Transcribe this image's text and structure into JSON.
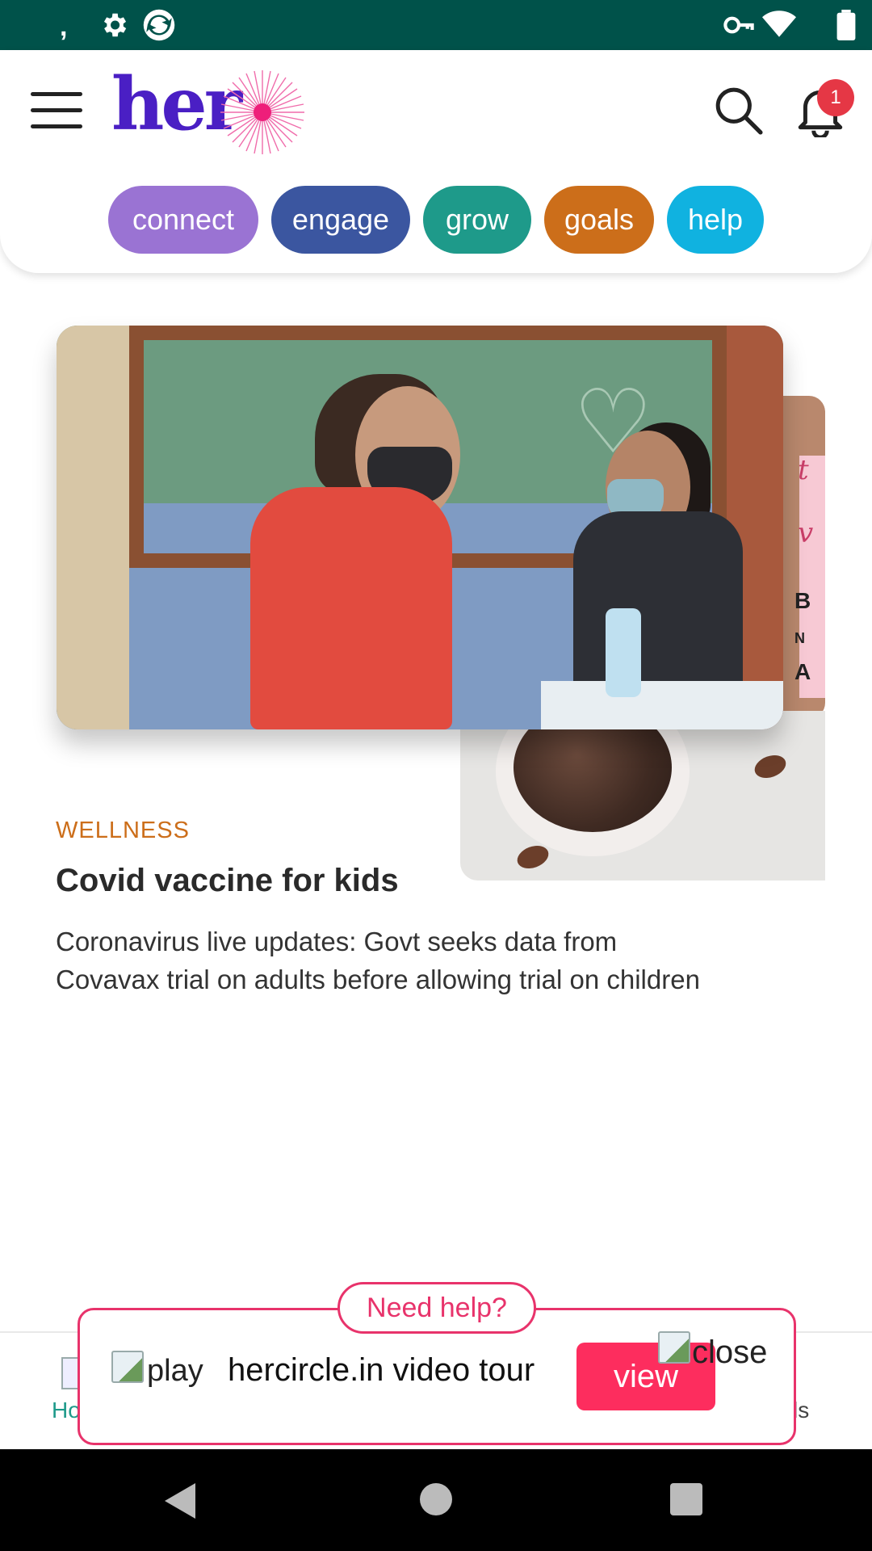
{
  "status_bar": {
    "left_text": ",",
    "icons": [
      "settings-gear-icon",
      "app-notification-icon",
      "vpn-key-icon",
      "wifi-icon",
      "battery-icon"
    ],
    "background_color": "#00524a"
  },
  "header": {
    "logo_text": "her",
    "notification_count": "1",
    "icons": [
      "menu-icon",
      "search-icon",
      "bell-icon"
    ],
    "pills": [
      {
        "label": "connect",
        "color": "#9a73d3"
      },
      {
        "label": "engage",
        "color": "#3b56a0"
      },
      {
        "label": "grow",
        "color": "#1e9a8a"
      },
      {
        "label": "goals",
        "color": "#cc6e1a"
      },
      {
        "label": "help",
        "color": "#10b2e0"
      }
    ]
  },
  "featured": {
    "category": "WELLNESS",
    "title": "Covid vaccine for kids",
    "summary": "Coronavirus live updates: Govt seeks data from Covavax trial on adults before allowing trial on children",
    "category_color": "#cc6e1a"
  },
  "bottom_nav": {
    "home_label": "Ho",
    "goals_label": "ls"
  },
  "help_popup": {
    "tab_label": "Need help?",
    "play_alt": "play",
    "tour_text": "hercircle.in video tour",
    "view_label": "view",
    "close_alt": "close",
    "accent_color": "#e8336b",
    "button_color": "#fd2d5e"
  },
  "system_nav": {
    "icons": [
      "back-icon",
      "home-icon",
      "recents-icon"
    ]
  }
}
